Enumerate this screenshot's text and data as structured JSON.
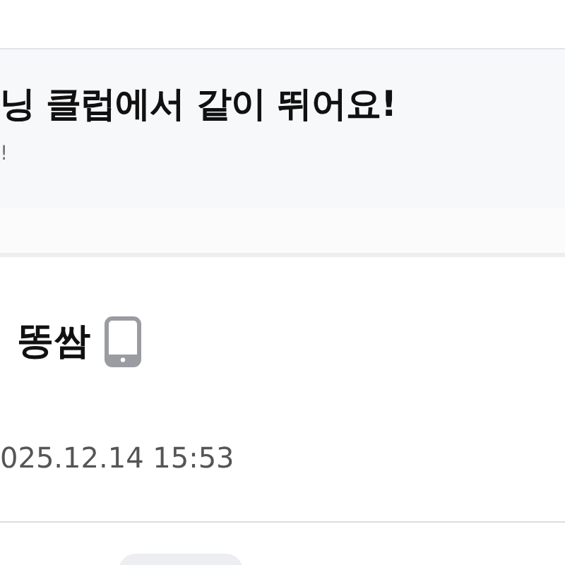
{
  "banner": {
    "title": "닝 클럽에서 같이 뛰어요!",
    "subtitle": "!"
  },
  "post": {
    "author": "똥쌈",
    "date": "025.12.14 15:53"
  }
}
